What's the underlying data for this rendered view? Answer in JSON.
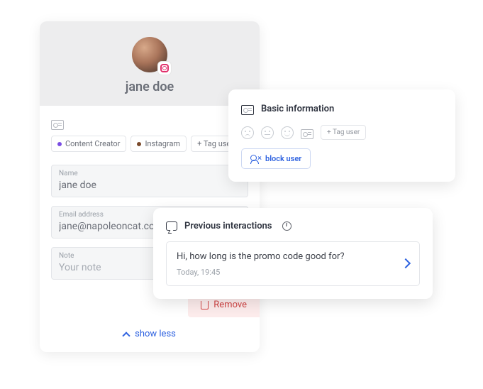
{
  "profile": {
    "name": "jane doe",
    "tags": [
      {
        "label": "Content Creator",
        "dot": "dot-purple"
      },
      {
        "label": "Instagram",
        "dot": "dot-brown"
      }
    ],
    "add_tag_label": "+ Tag user",
    "fields": {
      "name_label": "Name",
      "name_value": "jane doe",
      "email_label": "Email address",
      "email_value": "jane@napoleoncat.com",
      "note_label": "Note",
      "note_placeholder": "Your note"
    },
    "remove_label": "Remove",
    "show_less_label": "show less"
  },
  "basic_info": {
    "title": "Basic information",
    "add_tag_label": "+ Tag user",
    "block_label": "block user"
  },
  "interactions": {
    "title": "Previous interactions",
    "item": {
      "text": "Hi, how long is the promo code good for?",
      "time": "Today, 19:45"
    }
  }
}
